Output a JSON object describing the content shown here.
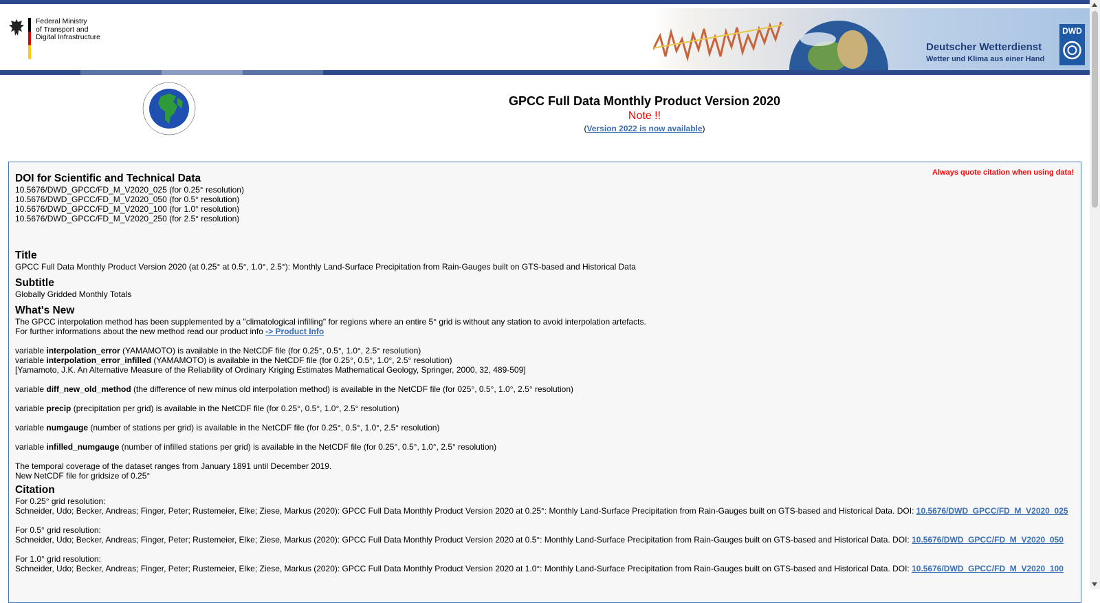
{
  "header": {
    "ministry": [
      "Federal Ministry",
      "of Transport and",
      "Digital Infrastructure"
    ],
    "dwd_name": "Deutscher Wetterdienst",
    "dwd_tagline": "Wetter und Klima aus einer Hand",
    "dwd_logo_text": "DWD"
  },
  "colors": {
    "nav": "#2c4a8c",
    "link": "#3b6fb5",
    "alert": "#ff0000",
    "border": "#4a7ab5"
  },
  "title": {
    "main": "GPCC Full Data Monthly Product Version 2020",
    "note": "Note !!",
    "open_paren": "(",
    "link": "Version 2022 is now available",
    "close_paren": ")"
  },
  "quote_notice": "Always quote citation when using data!",
  "doi": {
    "heading": "DOI for Scientific and Technical Data",
    "items": [
      "10.5676/DWD_GPCC/FD_M_V2020_025 (for 0.25° resolution)",
      "10.5676/DWD_GPCC/FD_M_V2020_050 (for 0.5° resolution)",
      "10.5676/DWD_GPCC/FD_M_V2020_100 (for 1.0° resolution)",
      "10.5676/DWD_GPCC/FD_M_V2020_250 (for 2.5° resolution)"
    ]
  },
  "title_section": {
    "heading": "Title",
    "text": "GPCC Full Data Monthly Product Version 2020 (at 0.25° at 0.5°, 1.0°, 2.5°): Monthly Land-Surface Precipitation from Rain-Gauges built on GTS-based and Historical Data"
  },
  "subtitle_section": {
    "heading": "Subtitle",
    "text": "Globally Gridded Monthly Totals"
  },
  "whats_new": {
    "heading": "What's New",
    "line1": "The GPCC interpolation method has been supplemented by a \"climatological infilling\" for regions where an entire 5° grid is without any station to avoid interpolation artefacts.",
    "line2_prefix": "For further informations about the new method read our product info ",
    "line2_link": "-> Product Info",
    "var_prefix": "variable ",
    "v1_name": "interpolation_error",
    "v1_text": " (YAMAMOTO) is available in the NetCDF file (for 0.25°, 0.5°, 1.0°, 2.5° resolution)",
    "v2_name": "interpolation_error_infilled",
    "v2_text": " (YAMAMOTO) is available in the NetCDF file (for 0.25°, 0.5°, 1.0°, 2.5° resolution)",
    "ref": "[Yamamoto, J.K. An Alternative Measure of the Reliability of Ordinary Kriging Estimates Mathematical Geology, Springer, 2000, 32, 489-509]",
    "v3_name": "diff_new_old_method",
    "v3_text": " (the difference of new minus old interpolation method) is available in the NetCDF file (for 025°, 0.5°, 1.0°, 2.5° resolution)",
    "v4_name": "precip",
    "v4_text": " (precipitation per grid) is available in the NetCDF file (for 0.25°, 0.5°, 1.0°, 2.5° resolution)",
    "v5_name": "numgauge",
    "v5_text": " (number of stations per grid) is available in the NetCDF file (for 0.25°, 0.5°, 1.0°, 2.5° resolution)",
    "v6_name": "infilled_numgauge",
    "v6_text": " (number of infilled stations per grid) is available in the NetCDF file (for 0.25°, 0.5°, 1.0°, 2.5° resolution)",
    "coverage": "The temporal coverage of the dataset ranges from January 1891 until December 2019.",
    "netcdf": "New NetCDF file for gridsize of 0.25°"
  },
  "citation": {
    "heading": "Citation",
    "entries": [
      {
        "label": "For 0.25° grid resolution:",
        "text": "Schneider, Udo; Becker, Andreas; Finger, Peter; Rustemeier, Elke; Ziese, Markus (2020): GPCC Full Data Monthly Product Version 2020 at 0.25°: Monthly Land-Surface Precipitation from Rain-Gauges built on GTS-based and Historical Data. DOI: ",
        "doi": "10.5676/DWD_GPCC/FD_M_V2020_025"
      },
      {
        "label": "For 0.5° grid resolution:",
        "text": "Schneider, Udo; Becker, Andreas; Finger, Peter; Rustemeier, Elke; Ziese, Markus (2020): GPCC Full Data Monthly Product Version 2020 at 0.5°: Monthly Land-Surface Precipitation from Rain-Gauges built on GTS-based and Historical Data. DOI: ",
        "doi": "10.5676/DWD_GPCC/FD_M_V2020_050"
      },
      {
        "label": "For 1.0° grid resolution:",
        "text": "Schneider, Udo; Becker, Andreas; Finger, Peter; Rustemeier, Elke; Ziese, Markus (2020): GPCC Full Data Monthly Product Version 2020 at 1.0°: Monthly Land-Surface Precipitation from Rain-Gauges built on GTS-based and Historical Data. DOI: ",
        "doi": "10.5676/DWD_GPCC/FD_M_V2020_100"
      }
    ]
  }
}
